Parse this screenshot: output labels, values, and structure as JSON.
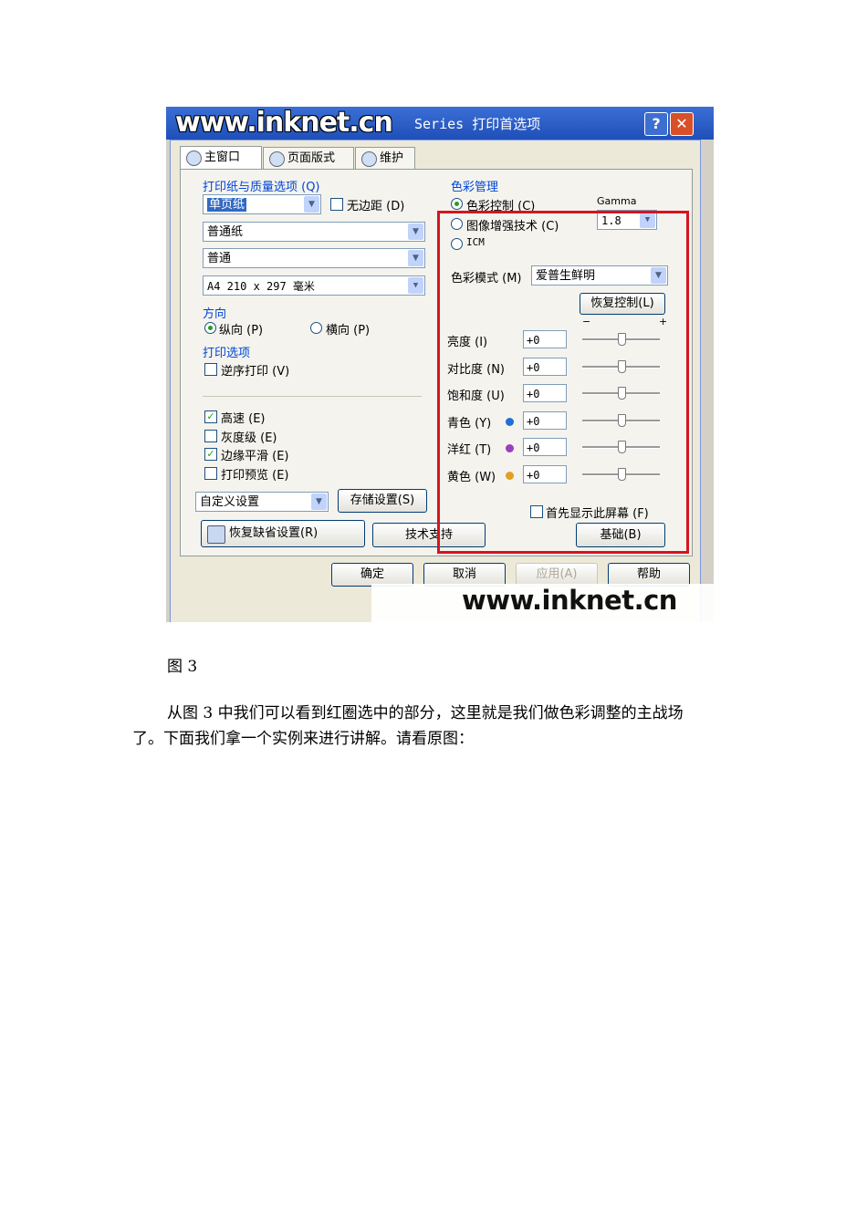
{
  "screenshot": {
    "watermark_top": "www.inknet.cn",
    "title": "Series 打印首选项",
    "help_glyph": "?",
    "close_glyph": "✕",
    "tabs": [
      {
        "label": "主窗口",
        "icon": "printer-icon"
      },
      {
        "label": "页面版式",
        "icon": "layout-icon"
      },
      {
        "label": "维护",
        "icon": "tools-icon"
      }
    ],
    "paper_group": {
      "label": "打印纸与质量选项 (Q)",
      "media_combo": "单页纸",
      "borderless_label": "无边距 (D)",
      "type_combo": "普通纸",
      "quality_combo": "普通",
      "size_combo": "A4 210 x 297 毫米"
    },
    "orientation": {
      "label": "方向",
      "portrait": "纵向 (P)",
      "landscape": "横向 (P)"
    },
    "print_options": {
      "label": "打印选项",
      "reverse": "逆序打印 (V)",
      "high_speed": "高速 (E)",
      "grayscale": "灰度级 (E)",
      "edge_smoothing": "边缘平滑 (E)",
      "preview": "打印预览 (E)"
    },
    "custom_combo": "自定义设置",
    "save_settings_button": "存储设置(S)",
    "restore_defaults_button": "恢复缺省设置(R)",
    "tech_support_button": "技术支持",
    "basic_button": "基础(B)",
    "show_first_label": "首先显示此屏幕 (F)",
    "color_management": {
      "label": "色彩管理",
      "color_control": "色彩控制 (C)",
      "photo_enhance": "图像增强技术 (C)",
      "icm": "ICM",
      "gamma_label": "Gamma",
      "gamma_value": "1.8",
      "mode_label": "色彩模式 (M)",
      "mode_value": "爱普生鲜明",
      "restore_control_button": "恢复控制(L)",
      "slider_minus": "−",
      "slider_plus": "+",
      "adjustments": [
        {
          "label": "亮度 (I)",
          "value": "+0",
          "dot": null,
          "level": 0.5
        },
        {
          "label": "对比度 (N)",
          "value": "+0",
          "dot": null,
          "level": 0.5
        },
        {
          "label": "饱和度 (U)",
          "value": "+0",
          "dot": null,
          "level": 0.5
        },
        {
          "label": "青色 (Y)",
          "value": "+0",
          "dot": "#1f6fd6",
          "level": 0.5
        },
        {
          "label": "洋红 (T)",
          "value": "+0",
          "dot": "#9a3fbf",
          "level": 0.5
        },
        {
          "label": "黄色 (W)",
          "value": "+0",
          "dot": "#e0a020",
          "level": 0.5
        }
      ]
    },
    "bottom_buttons": [
      "确定",
      "取消",
      "应用(A)",
      "帮助"
    ],
    "watermark_bottom": "www.inknet.cn",
    "highlight_color": "#d8141e"
  },
  "document": {
    "caption": "图 3",
    "paragraph_line1": "从图 3 中我们可以看到红圈选中的部分，这里就是我们做色彩调整的主战场",
    "paragraph_line2": "了。下面我们拿一个实例来进行讲解。请看原图："
  }
}
